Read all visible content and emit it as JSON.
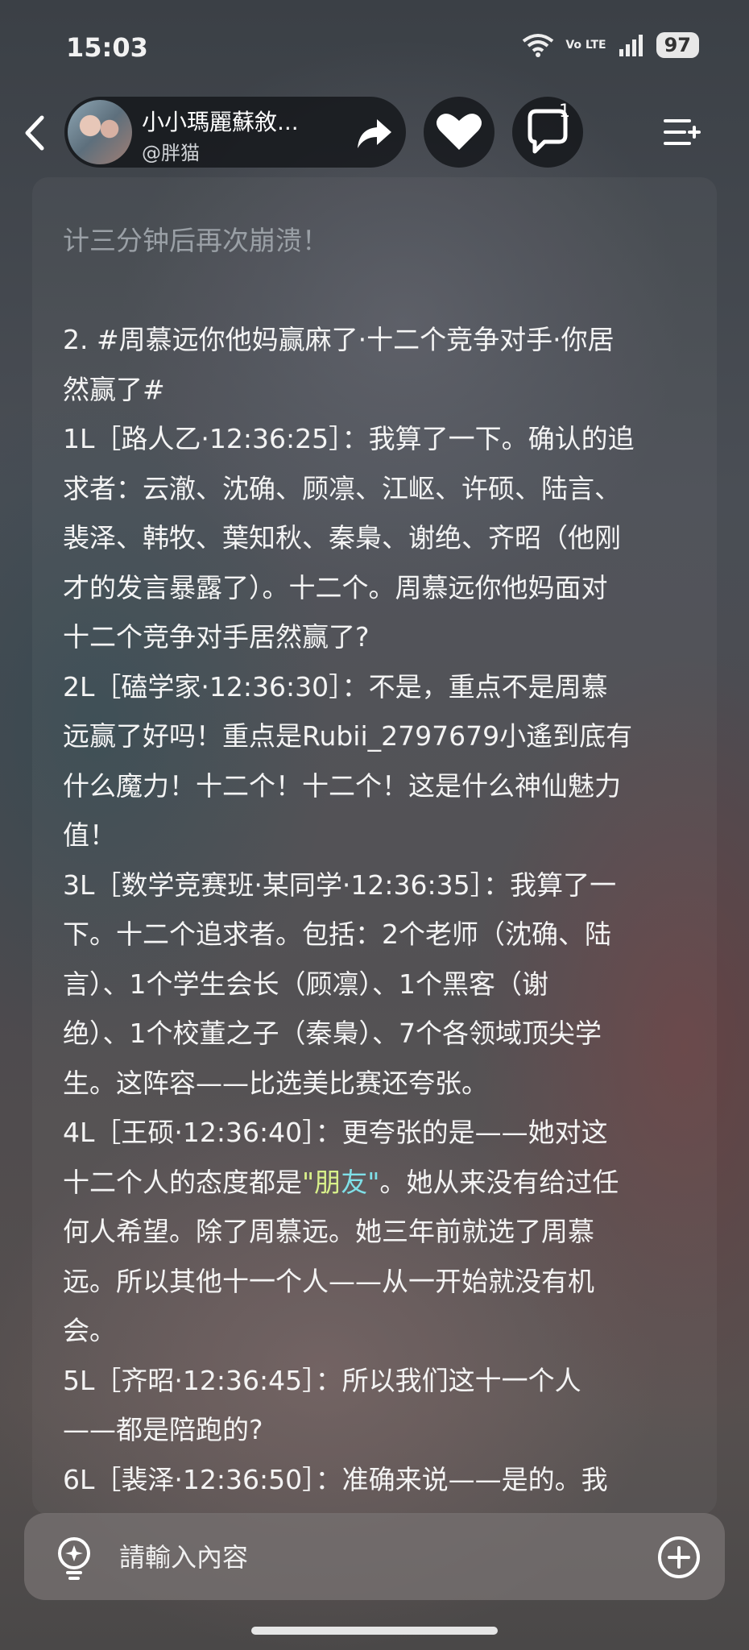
{
  "status": {
    "time": "15:03",
    "network": "Vo LTE",
    "battery": "97"
  },
  "header": {
    "name": "小小瑪麗蘇敘...",
    "handle": "@胖猫",
    "comment_count": "1"
  },
  "content": {
    "lines": [
      "计三分钟后再次崩溃！",
      "",
      "2. #周慕远你他妈赢麻了·十二个竞争对手·你居",
      "然赢了#",
      "1L［路人乙·12:36:25］：我算了一下。确认的追",
      "求者：云澈、沈确、顾凛、江岖、许硕、陆言、",
      "裴泽、韩牧、葉知秋、秦梟、谢绝、齐昭（他刚",
      "才的发言暴露了）。十二个。周慕远你他妈面对",
      "十二个竞争对手居然赢了?",
      "2L［磕学家·12:36:30］：不是，重点不是周慕",
      "远赢了好吗！重点是Rubii_2797679小遙到底有",
      "什么魔力！十二个！十二个！这是什么神仙魅力",
      "值！",
      "3L［数学竞赛班·某同学·12:36:35］：我算了一",
      "下。十二个追求者。包括：2个老师（沈确、陆",
      "言）、1个学生会长（顾凛）、1个黑客（谢",
      "绝）、1个校董之子（秦梟）、7个各领域顶尖学",
      "生。这阵容——比选美比赛还夸张。",
      "4L［王硕·12:36:40］：更夸张的是——她对这"
    ],
    "line_20_pre": "十二个人的态度都是",
    "line_20_quote_a": "\"朋",
    "line_20_quote_b": "友\"",
    "line_20_post": "。她从来没有给过任",
    "lines_after": [
      "何人希望。除了周慕远。她三年前就选了周慕",
      "远。所以其他十一个人——从一开始就没有机",
      "会。",
      "5L［齐昭·12:36:45］：所以我们这十一个人",
      "——都是陪跑的?",
      "6L［裴泽·12:36:50］：准确来说——是的。我"
    ]
  },
  "input": {
    "placeholder": "請輸入內容"
  },
  "colors": {
    "quote_a": "#d8f08a",
    "quote_b": "#7fe0e8"
  }
}
